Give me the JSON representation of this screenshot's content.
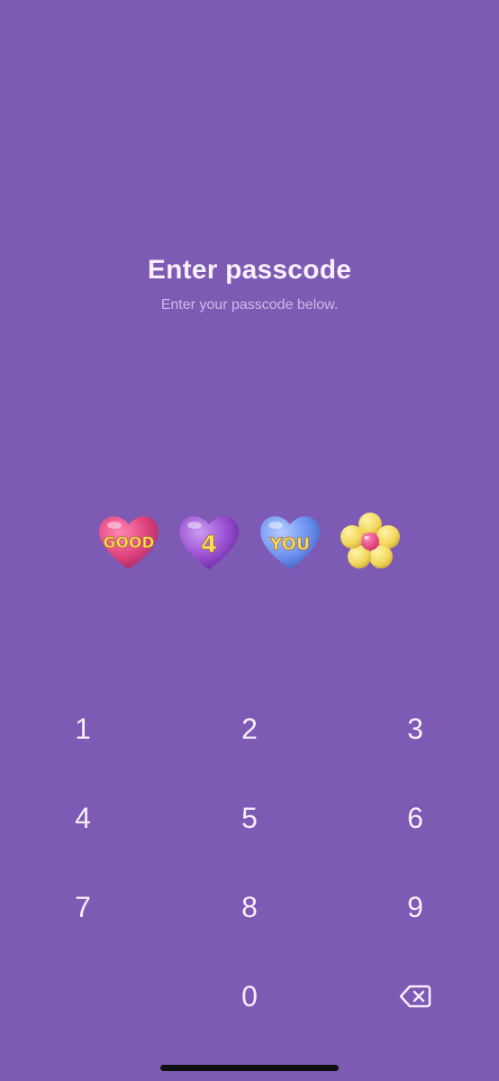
{
  "screen": {
    "title": "Enter passcode",
    "subtitle": "Enter your passcode below."
  },
  "passcode_stickers": [
    {
      "name": "pink-heart-good",
      "text": "GOOD",
      "color": "#E0447F"
    },
    {
      "name": "purple-heart-4",
      "text": "4",
      "color": "#9B4FD1"
    },
    {
      "name": "blue-heart-you",
      "text": "YOU",
      "color": "#6E93F0"
    },
    {
      "name": "yellow-flower",
      "text": "",
      "color": "#F2D65A"
    }
  ],
  "keypad": {
    "keys": [
      "1",
      "2",
      "3",
      "4",
      "5",
      "6",
      "7",
      "8",
      "9",
      "0"
    ],
    "backspace_icon": "backspace-icon"
  },
  "colors": {
    "background": "#7D5AB3",
    "text": "#F6EEFF",
    "subtext": "#CDBBE8"
  }
}
